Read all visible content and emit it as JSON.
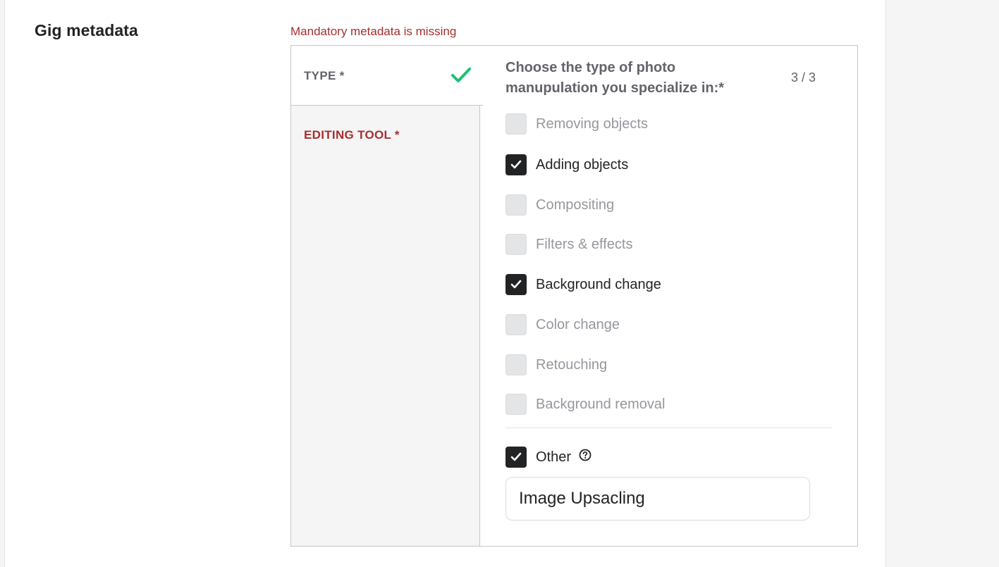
{
  "section": {
    "title": "Gig metadata",
    "error": "Mandatory metadata is missing"
  },
  "nav": {
    "type_label": "TYPE *",
    "editing_tool_label": "EDITING TOOL *"
  },
  "question": {
    "text": "Choose the type of photo manupulation you specialize in:*",
    "counter": "3 / 3"
  },
  "options": [
    {
      "label": "Removing objects",
      "checked": false
    },
    {
      "label": "Adding objects",
      "checked": true
    },
    {
      "label": "Compositing",
      "checked": false
    },
    {
      "label": "Filters & effects",
      "checked": false
    },
    {
      "label": "Background change",
      "checked": true
    },
    {
      "label": "Color change",
      "checked": false
    },
    {
      "label": "Retouching",
      "checked": false
    },
    {
      "label": "Background removal",
      "checked": false
    }
  ],
  "other": {
    "label": "Other",
    "checked": true,
    "value": "Image Upsacling"
  },
  "colors": {
    "error": "#a72f2f",
    "success": "#1dbf73",
    "checked_box": "#222325",
    "disabled_text": "#95979d"
  },
  "icons": {
    "type_status": "checkmark-icon",
    "other_help": "question-circle-icon"
  }
}
